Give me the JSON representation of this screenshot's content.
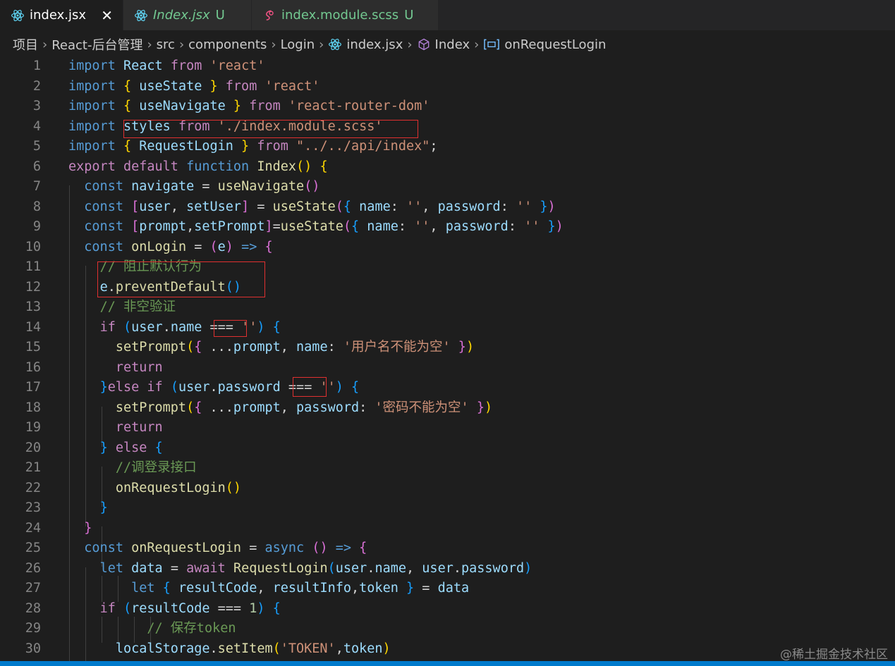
{
  "tabs": [
    {
      "label": "index.jsx",
      "icon": "react-icon",
      "active": true,
      "close": "✕"
    },
    {
      "label": "Index.jsx",
      "icon": "react-icon",
      "status": "U"
    },
    {
      "label": "index.module.scss",
      "icon": "sass-icon",
      "status": "U"
    }
  ],
  "breadcrumb": [
    "项目",
    "React-后台管理",
    "src",
    "components",
    "Login",
    "index.jsx",
    "Index",
    "onRequestLogin"
  ],
  "code_lines": [
    {
      "n": "1",
      "toks": [
        [
          "k",
          "import"
        ],
        [
          "p",
          " "
        ],
        [
          "v",
          "React"
        ],
        [
          "p",
          " "
        ],
        [
          "kc",
          "from"
        ],
        [
          "p",
          " "
        ],
        [
          "s",
          "'react'"
        ]
      ]
    },
    {
      "n": "2",
      "toks": [
        [
          "k",
          "import"
        ],
        [
          "p",
          " "
        ],
        [
          "b1",
          "{"
        ],
        [
          "p",
          " "
        ],
        [
          "v",
          "useState"
        ],
        [
          "p",
          " "
        ],
        [
          "b1",
          "}"
        ],
        [
          "p",
          " "
        ],
        [
          "kc",
          "from"
        ],
        [
          "p",
          " "
        ],
        [
          "s",
          "'react'"
        ]
      ]
    },
    {
      "n": "3",
      "toks": [
        [
          "k",
          "import"
        ],
        [
          "p",
          " "
        ],
        [
          "b1",
          "{"
        ],
        [
          "p",
          " "
        ],
        [
          "v",
          "useNavigate"
        ],
        [
          "p",
          " "
        ],
        [
          "b1",
          "}"
        ],
        [
          "p",
          " "
        ],
        [
          "kc",
          "from"
        ],
        [
          "p",
          " "
        ],
        [
          "s",
          "'react-router-dom'"
        ]
      ]
    },
    {
      "n": "4",
      "toks": [
        [
          "k",
          "import"
        ],
        [
          "p",
          " "
        ],
        [
          "v",
          "styles"
        ],
        [
          "p",
          " "
        ],
        [
          "kc",
          "from"
        ],
        [
          "p",
          " "
        ],
        [
          "s",
          "'./index.module.scss'"
        ]
      ]
    },
    {
      "n": "5",
      "toks": [
        [
          "k",
          "import"
        ],
        [
          "p",
          " "
        ],
        [
          "b1",
          "{"
        ],
        [
          "p",
          " "
        ],
        [
          "v",
          "RequestLogin"
        ],
        [
          "p",
          " "
        ],
        [
          "b1",
          "}"
        ],
        [
          "p",
          " "
        ],
        [
          "kc",
          "from"
        ],
        [
          "p",
          " "
        ],
        [
          "s",
          "\"../../api/index\""
        ],
        [
          "p",
          ";"
        ]
      ]
    },
    {
      "n": "6",
      "toks": [
        [
          "kc",
          "export"
        ],
        [
          "p",
          " "
        ],
        [
          "kc",
          "default"
        ],
        [
          "p",
          " "
        ],
        [
          "k",
          "function"
        ],
        [
          "p",
          " "
        ],
        [
          "f",
          "Index"
        ],
        [
          "b1",
          "()"
        ],
        [
          "p",
          " "
        ],
        [
          "b1",
          "{"
        ]
      ]
    },
    {
      "n": "7",
      "toks": [
        [
          "p",
          "  "
        ],
        [
          "k",
          "const"
        ],
        [
          "p",
          " "
        ],
        [
          "v",
          "navigate"
        ],
        [
          "p",
          " = "
        ],
        [
          "f",
          "useNavigate"
        ],
        [
          "b2",
          "()"
        ]
      ]
    },
    {
      "n": "8",
      "toks": [
        [
          "p",
          "  "
        ],
        [
          "k",
          "const"
        ],
        [
          "p",
          " "
        ],
        [
          "b2",
          "["
        ],
        [
          "v",
          "user"
        ],
        [
          "p",
          ", "
        ],
        [
          "v",
          "setUser"
        ],
        [
          "b2",
          "]"
        ],
        [
          "p",
          " = "
        ],
        [
          "f",
          "useState"
        ],
        [
          "b2",
          "("
        ],
        [
          "b3",
          "{"
        ],
        [
          "p",
          " "
        ],
        [
          "v",
          "name"
        ],
        [
          "p",
          ": "
        ],
        [
          "s",
          "''"
        ],
        [
          "p",
          ", "
        ],
        [
          "v",
          "password"
        ],
        [
          "p",
          ": "
        ],
        [
          "s",
          "''"
        ],
        [
          "p",
          " "
        ],
        [
          "b3",
          "}"
        ],
        [
          "b2",
          ")"
        ]
      ]
    },
    {
      "n": "9",
      "toks": [
        [
          "p",
          "  "
        ],
        [
          "k",
          "const"
        ],
        [
          "p",
          " "
        ],
        [
          "b2",
          "["
        ],
        [
          "v",
          "prompt"
        ],
        [
          "p",
          ","
        ],
        [
          "v",
          "setPrompt"
        ],
        [
          "b2",
          "]"
        ],
        [
          "p",
          "="
        ],
        [
          "f",
          "useState"
        ],
        [
          "b2",
          "("
        ],
        [
          "b3",
          "{"
        ],
        [
          "p",
          " "
        ],
        [
          "v",
          "name"
        ],
        [
          "p",
          ": "
        ],
        [
          "s",
          "''"
        ],
        [
          "p",
          ", "
        ],
        [
          "v",
          "password"
        ],
        [
          "p",
          ": "
        ],
        [
          "s",
          "''"
        ],
        [
          "p",
          " "
        ],
        [
          "b3",
          "}"
        ],
        [
          "b2",
          ")"
        ]
      ]
    },
    {
      "n": "10",
      "toks": [
        [
          "p",
          "  "
        ],
        [
          "k",
          "const"
        ],
        [
          "p",
          " "
        ],
        [
          "f",
          "onLogin"
        ],
        [
          "p",
          " = "
        ],
        [
          "b2",
          "("
        ],
        [
          "v",
          "e"
        ],
        [
          "b2",
          ")"
        ],
        [
          "p",
          " "
        ],
        [
          "k",
          "=>"
        ],
        [
          "p",
          " "
        ],
        [
          "b2",
          "{"
        ]
      ]
    },
    {
      "n": "11",
      "toks": [
        [
          "p",
          "    "
        ],
        [
          "c",
          "// 阻止默认行为"
        ]
      ]
    },
    {
      "n": "12",
      "toks": [
        [
          "p",
          "    "
        ],
        [
          "v",
          "e"
        ],
        [
          "p",
          "."
        ],
        [
          "f",
          "preventDefault"
        ],
        [
          "b3",
          "()"
        ]
      ]
    },
    {
      "n": "13",
      "toks": [
        [
          "p",
          "    "
        ],
        [
          "c",
          "// 非空验证"
        ]
      ]
    },
    {
      "n": "14",
      "toks": [
        [
          "p",
          "    "
        ],
        [
          "kc",
          "if"
        ],
        [
          "p",
          " "
        ],
        [
          "b3",
          "("
        ],
        [
          "v",
          "user"
        ],
        [
          "p",
          "."
        ],
        [
          "v",
          "name"
        ],
        [
          "p",
          " === "
        ],
        [
          "s",
          "''"
        ],
        [
          "b3",
          ")"
        ],
        [
          "p",
          " "
        ],
        [
          "b3",
          "{"
        ]
      ]
    },
    {
      "n": "15",
      "toks": [
        [
          "p",
          "      "
        ],
        [
          "f",
          "setPrompt"
        ],
        [
          "b1",
          "("
        ],
        [
          "b2",
          "{"
        ],
        [
          "p",
          " ..."
        ],
        [
          "v",
          "prompt"
        ],
        [
          "p",
          ", "
        ],
        [
          "v",
          "name"
        ],
        [
          "p",
          ": "
        ],
        [
          "s",
          "'用户名不能为空'"
        ],
        [
          "p",
          " "
        ],
        [
          "b2",
          "}"
        ],
        [
          "b1",
          ")"
        ]
      ]
    },
    {
      "n": "16",
      "toks": [
        [
          "p",
          "      "
        ],
        [
          "kc",
          "return"
        ]
      ]
    },
    {
      "n": "17",
      "toks": [
        [
          "p",
          "    "
        ],
        [
          "b3",
          "}"
        ],
        [
          "kc",
          "else"
        ],
        [
          "p",
          " "
        ],
        [
          "kc",
          "if"
        ],
        [
          "p",
          " "
        ],
        [
          "b3",
          "("
        ],
        [
          "v",
          "user"
        ],
        [
          "p",
          "."
        ],
        [
          "v",
          "password"
        ],
        [
          "p",
          " === "
        ],
        [
          "s",
          "''"
        ],
        [
          "b3",
          ")"
        ],
        [
          "p",
          " "
        ],
        [
          "b3",
          "{"
        ]
      ]
    },
    {
      "n": "18",
      "toks": [
        [
          "p",
          "      "
        ],
        [
          "f",
          "setPrompt"
        ],
        [
          "b1",
          "("
        ],
        [
          "b2",
          "{"
        ],
        [
          "p",
          " ..."
        ],
        [
          "v",
          "prompt"
        ],
        [
          "p",
          ", "
        ],
        [
          "v",
          "password"
        ],
        [
          "p",
          ": "
        ],
        [
          "s",
          "'密码不能为空'"
        ],
        [
          "p",
          " "
        ],
        [
          "b2",
          "}"
        ],
        [
          "b1",
          ")"
        ]
      ]
    },
    {
      "n": "19",
      "toks": [
        [
          "p",
          "      "
        ],
        [
          "kc",
          "return"
        ]
      ]
    },
    {
      "n": "20",
      "toks": [
        [
          "p",
          "    "
        ],
        [
          "b3",
          "}"
        ],
        [
          "p",
          " "
        ],
        [
          "kc",
          "else"
        ],
        [
          "p",
          " "
        ],
        [
          "b3",
          "{"
        ]
      ]
    },
    {
      "n": "21",
      "toks": [
        [
          "p",
          "      "
        ],
        [
          "c",
          "//调登录接口"
        ]
      ]
    },
    {
      "n": "22",
      "toks": [
        [
          "p",
          "      "
        ],
        [
          "f",
          "onRequestLogin"
        ],
        [
          "b1",
          "()"
        ]
      ]
    },
    {
      "n": "23",
      "toks": [
        [
          "p",
          "    "
        ],
        [
          "b3",
          "}"
        ]
      ]
    },
    {
      "n": "24",
      "toks": [
        [
          "p",
          "  "
        ],
        [
          "b2",
          "}"
        ]
      ]
    },
    {
      "n": "25",
      "toks": [
        [
          "p",
          "  "
        ],
        [
          "k",
          "const"
        ],
        [
          "p",
          " "
        ],
        [
          "f",
          "onRequestLogin"
        ],
        [
          "p",
          " = "
        ],
        [
          "k",
          "async"
        ],
        [
          "p",
          " "
        ],
        [
          "b2",
          "()"
        ],
        [
          "p",
          " "
        ],
        [
          "k",
          "=>"
        ],
        [
          "p",
          " "
        ],
        [
          "b2",
          "{"
        ]
      ]
    },
    {
      "n": "26",
      "toks": [
        [
          "p",
          "    "
        ],
        [
          "k",
          "let"
        ],
        [
          "p",
          " "
        ],
        [
          "v",
          "data"
        ],
        [
          "p",
          " = "
        ],
        [
          "kc",
          "await"
        ],
        [
          "p",
          " "
        ],
        [
          "f",
          "RequestLogin"
        ],
        [
          "b3",
          "("
        ],
        [
          "v",
          "user"
        ],
        [
          "p",
          "."
        ],
        [
          "v",
          "name"
        ],
        [
          "p",
          ", "
        ],
        [
          "v",
          "user"
        ],
        [
          "p",
          "."
        ],
        [
          "v",
          "password"
        ],
        [
          "b3",
          ")"
        ]
      ]
    },
    {
      "n": "27",
      "toks": [
        [
          "p",
          "        "
        ],
        [
          "k",
          "let"
        ],
        [
          "p",
          " "
        ],
        [
          "b3",
          "{"
        ],
        [
          "p",
          " "
        ],
        [
          "v",
          "resultCode"
        ],
        [
          "p",
          ", "
        ],
        [
          "v",
          "resultInfo"
        ],
        [
          "p",
          ","
        ],
        [
          "v",
          "token"
        ],
        [
          "p",
          " "
        ],
        [
          "b3",
          "}"
        ],
        [
          "p",
          " = "
        ],
        [
          "v",
          "data"
        ]
      ]
    },
    {
      "n": "28",
      "toks": [
        [
          "p",
          "    "
        ],
        [
          "kc",
          "if"
        ],
        [
          "p",
          " "
        ],
        [
          "b3",
          "("
        ],
        [
          "v",
          "resultCode"
        ],
        [
          "p",
          " === "
        ],
        [
          "n",
          "1"
        ],
        [
          "b3",
          ")"
        ],
        [
          "p",
          " "
        ],
        [
          "b3",
          "{"
        ]
      ]
    },
    {
      "n": "29",
      "toks": [
        [
          "p",
          "          "
        ],
        [
          "c",
          "// 保存token"
        ]
      ]
    },
    {
      "n": "30",
      "toks": [
        [
          "p",
          "      "
        ],
        [
          "v",
          "localStorage"
        ],
        [
          "p",
          "."
        ],
        [
          "f",
          "setItem"
        ],
        [
          "b1",
          "("
        ],
        [
          "s",
          "'TOKEN'"
        ],
        [
          "p",
          ","
        ],
        [
          "v",
          "token"
        ],
        [
          "b1",
          ")"
        ]
      ]
    }
  ],
  "watermark": "@稀土掘金技术社区",
  "colors": {
    "accent": "#007acc",
    "highlight_box": "#e03030",
    "untracked": "#73c991"
  }
}
